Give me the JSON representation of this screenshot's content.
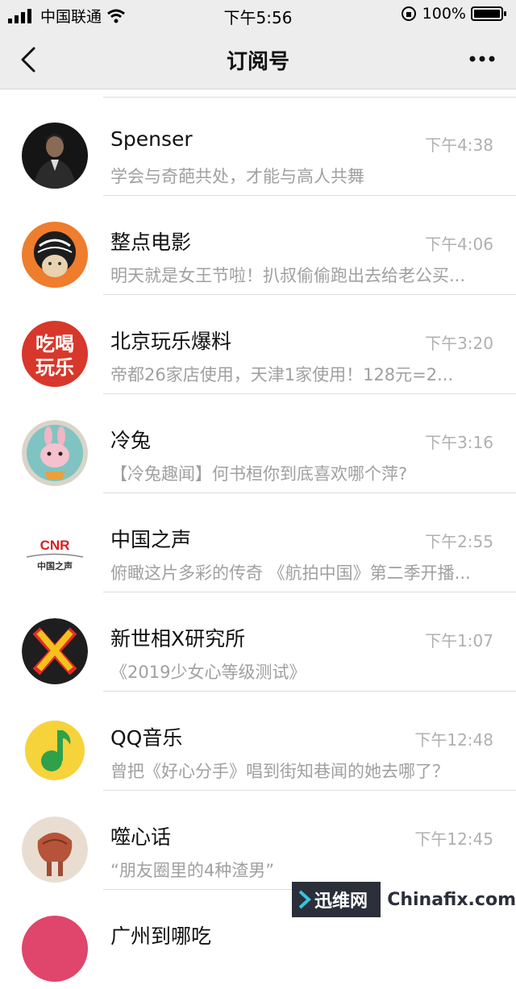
{
  "status_bar": {
    "carrier": "中国联通",
    "time": "下午5:56",
    "battery": "100%"
  },
  "nav": {
    "title": "订阅号"
  },
  "items": [
    {
      "name": "Spenser",
      "time": "下午4:38",
      "message": "学会与奇葩共处，才能与高人共舞",
      "icon": "spenser-avatar"
    },
    {
      "name": "整点电影",
      "time": "下午4:06",
      "message": "明天就是女王节啦！扒叔偷偷跑出去给老公买...",
      "icon": "zhengdian-movie-avatar"
    },
    {
      "name": "北京玩乐爆料",
      "time": "下午3:20",
      "message": "帝都26家店使用，天津1家使用！128元=2...",
      "icon": "chihe-wanle-avatar",
      "avatar_text": [
        "吃喝",
        "玩乐"
      ]
    },
    {
      "name": "冷兔",
      "time": "下午3:16",
      "message": "【冷兔趣闻】何书桓你到底喜欢哪个萍?",
      "icon": "rabbit-avatar"
    },
    {
      "name": "中国之声",
      "time": "下午2:55",
      "message": "俯瞰这片多彩的传奇 《航拍中国》第二季开播...",
      "icon": "cnr-avatar",
      "avatar_text": [
        "CNR",
        "中国之声"
      ]
    },
    {
      "name": "新世相X研究所",
      "time": "下午1:07",
      "message": "《2019少女心等级测试》",
      "icon": "x-avatar"
    },
    {
      "name": "QQ音乐",
      "time": "下午12:48",
      "message": "曾把《好心分手》唱到街知巷闻的她去哪了？",
      "icon": "qq-music-avatar"
    },
    {
      "name": "噬心话",
      "time": "下午12:45",
      "message": "“朋友圈里的4种渣男”",
      "icon": "shixinhua-avatar"
    },
    {
      "name": "广州到哪吃",
      "time": "",
      "message": "",
      "icon": "partial-avatar"
    }
  ],
  "watermark": {
    "left": "迅维网",
    "right": "Chinafix.com"
  },
  "colors": {
    "bar_bg": "#ededed",
    "name_text": "#111111",
    "secondary_text": "#a0a0a0",
    "divider": "#dcdcdc"
  }
}
